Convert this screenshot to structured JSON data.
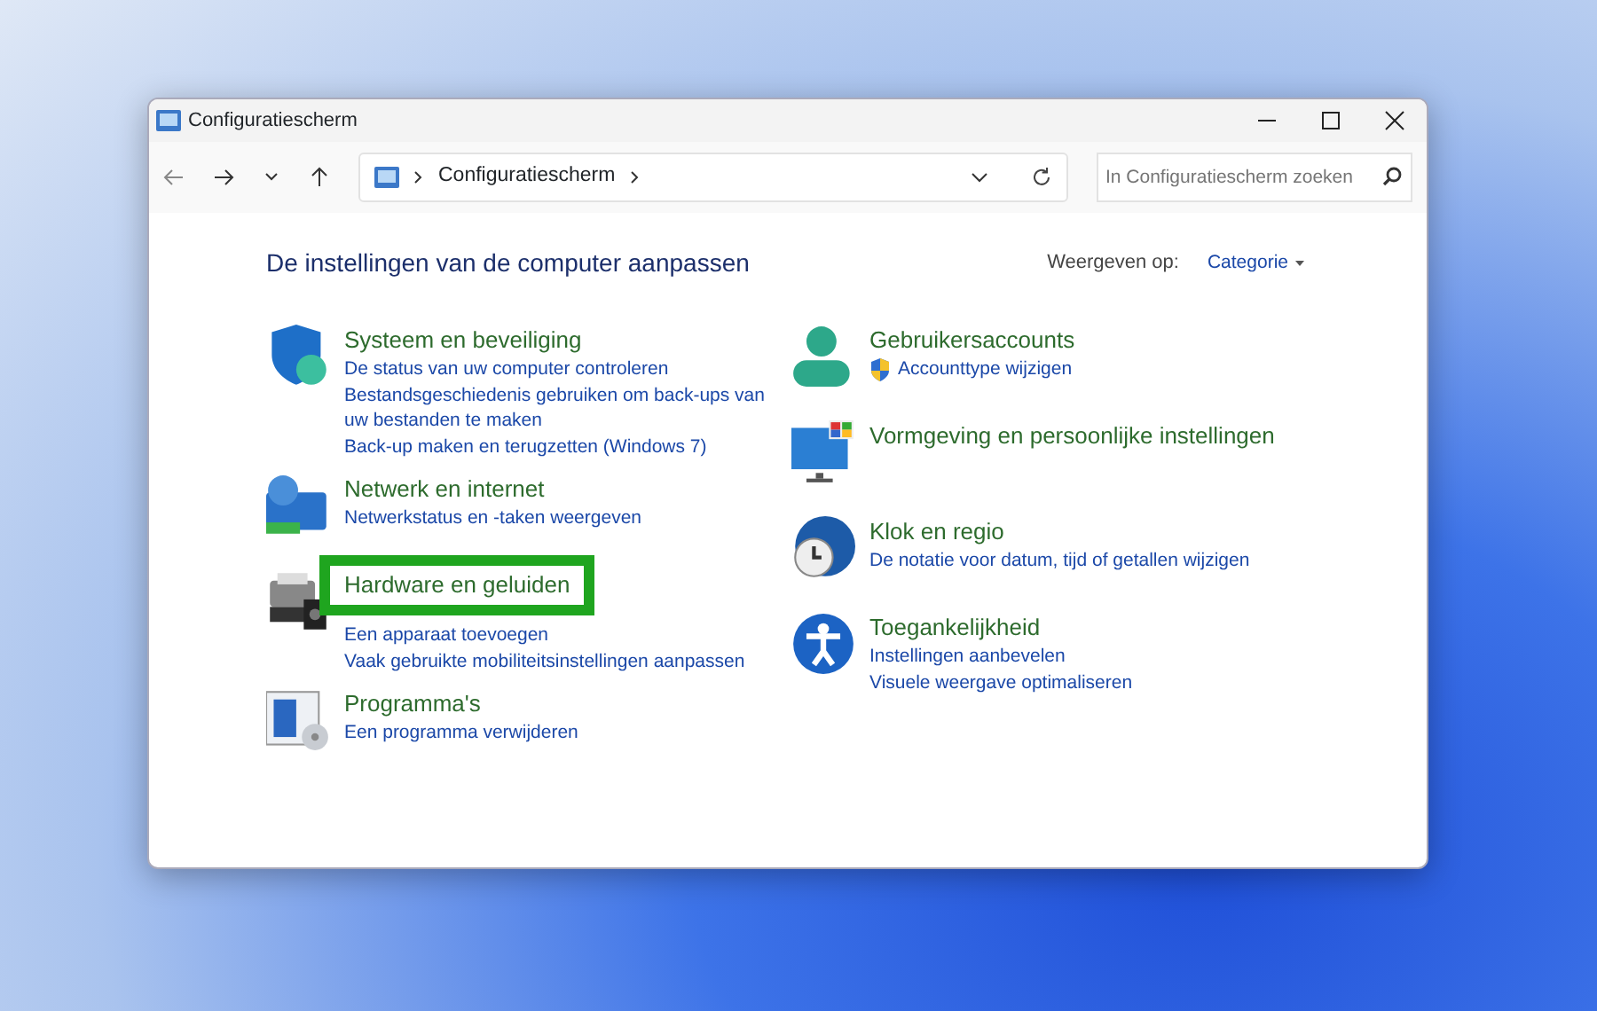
{
  "window": {
    "title": "Configuratiescherm"
  },
  "toolbar": {
    "breadcrumb": "Configuratiescherm",
    "search": {
      "placeholder": "In Configuratiescherm zoeken"
    }
  },
  "heading": "De instellingen van de computer aanpassen",
  "view_by": {
    "label": "Weergeven op:",
    "value": "Categorie"
  },
  "columns": [
    [
      {
        "kind": "shield",
        "title": "Systeem en beveiliging",
        "highlighted": false,
        "links": [
          {
            "text": "De status van uw computer controleren",
            "shield": false
          },
          {
            "text": "Bestandsgeschiedenis gebruiken om back-ups van uw bestanden te maken",
            "shield": false
          },
          {
            "text": "Back-up maken en terugzetten (Windows 7)",
            "shield": false
          }
        ]
      },
      {
        "kind": "network",
        "title": "Netwerk en internet",
        "highlighted": false,
        "links": [
          {
            "text": "Netwerkstatus en -taken weergeven",
            "shield": false
          }
        ]
      },
      {
        "kind": "printer",
        "title": "Hardware en geluiden",
        "highlighted": true,
        "links": [
          {
            "text": "Een apparaat toevoegen",
            "shield": false
          },
          {
            "text": "Vaak gebruikte mobiliteitsinstellingen aanpassen",
            "shield": false
          }
        ]
      },
      {
        "kind": "programs",
        "title": "Programma's",
        "highlighted": false,
        "links": [
          {
            "text": "Een programma verwijderen",
            "shield": false
          }
        ]
      }
    ],
    [
      {
        "kind": "user",
        "title": "Gebruikersaccounts",
        "highlighted": false,
        "links": [
          {
            "text": "Accounttype wijzigen",
            "shield": true
          }
        ]
      },
      {
        "kind": "monitor",
        "title": "Vormgeving en persoonlijke instellingen",
        "highlighted": false
      },
      {
        "kind": "clock",
        "title": "Klok en regio",
        "highlighted": false,
        "links": [
          {
            "text": "De notatie voor datum, tijd of getallen wijzigen",
            "shield": false
          }
        ]
      },
      {
        "kind": "accessibility",
        "title": "Toegankelijkheid",
        "highlighted": false,
        "links": [
          {
            "text": "Instellingen aanbevelen",
            "shield": false
          },
          {
            "text": "Visuele weergave optimaliseren",
            "shield": false
          }
        ]
      }
    ]
  ]
}
